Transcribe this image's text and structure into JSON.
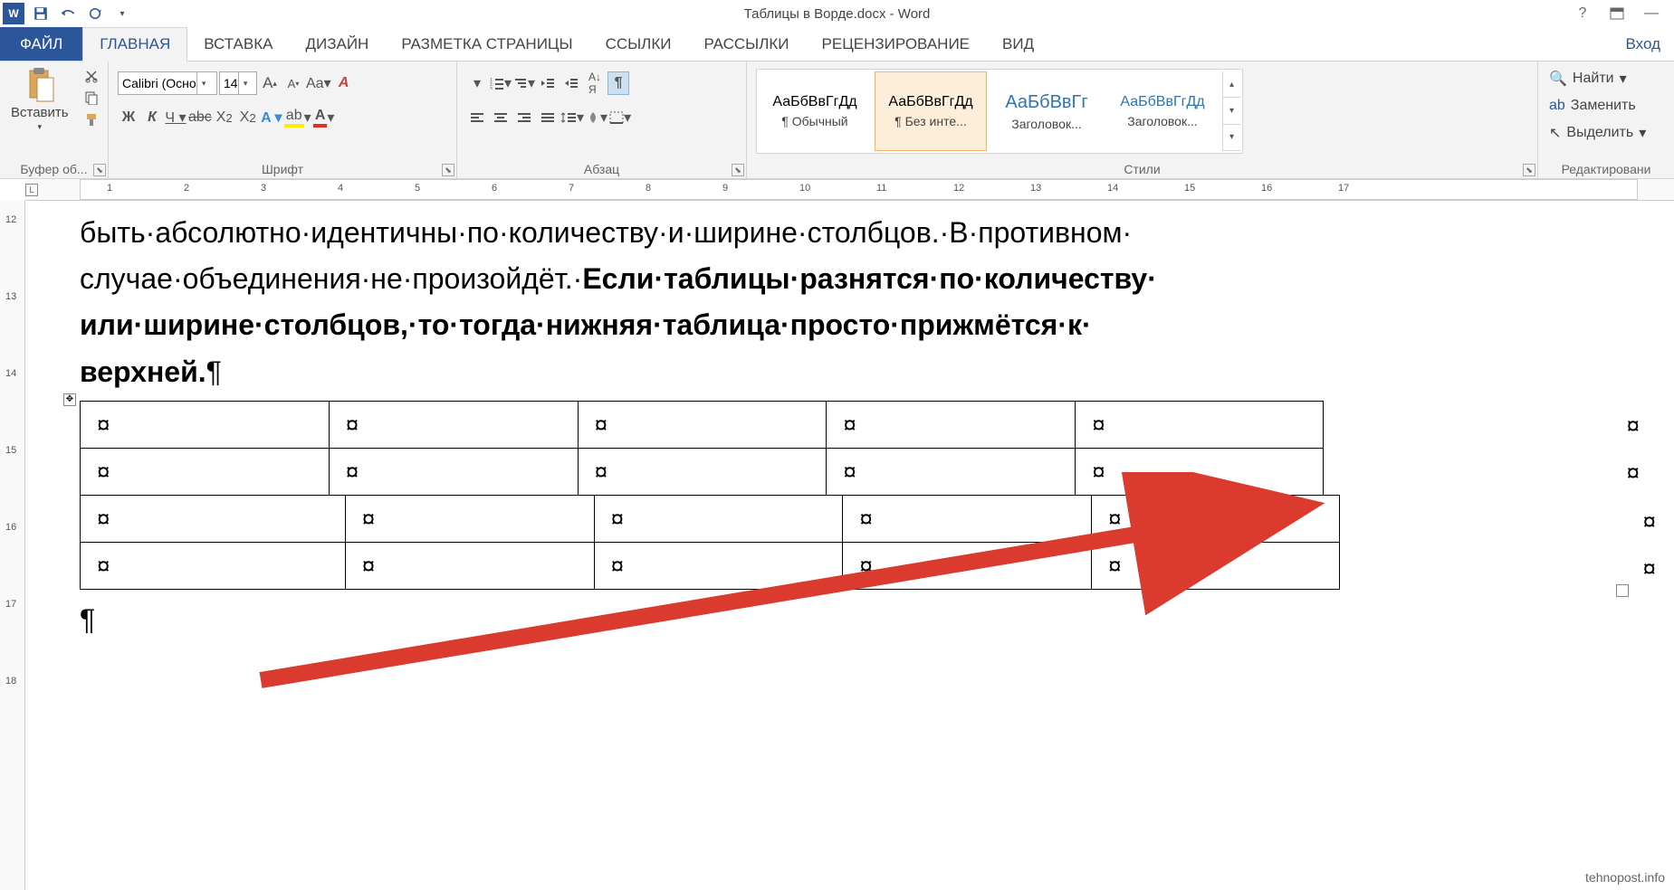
{
  "titlebar": {
    "title": "Таблицы в Ворде.docx - Word",
    "login": "Вход"
  },
  "tabs": {
    "file": "ФАЙЛ",
    "items": [
      "ГЛАВНАЯ",
      "ВСТАВКА",
      "ДИЗАЙН",
      "РАЗМЕТКА СТРАНИЦЫ",
      "ССЫЛКИ",
      "РАССЫЛКИ",
      "РЕЦЕНЗИРОВАНИЕ",
      "ВИД"
    ]
  },
  "ribbon": {
    "clipboard": {
      "paste": "Вставить",
      "label": "Буфер об..."
    },
    "font": {
      "name": "Calibri (Осно",
      "size": "14",
      "label": "Шрифт"
    },
    "paragraph": {
      "label": "Абзац"
    },
    "styles": {
      "label": "Стили",
      "items": [
        {
          "preview": "АаБбВвГгДд",
          "name": "¶ Обычный",
          "color": "#000"
        },
        {
          "preview": "АаБбВвГгДд",
          "name": "¶ Без инте...",
          "color": "#000"
        },
        {
          "preview": "АаБбВвГг",
          "name": "Заголовок...",
          "color": "#2e74b5"
        },
        {
          "preview": "АаБбВвГгДд",
          "name": "Заголовок...",
          "color": "#2e74b5"
        }
      ]
    },
    "editing": {
      "find": "Найти",
      "replace": "Заменить",
      "select": "Выделить",
      "label": "Редактировани"
    }
  },
  "ruler_h": [
    "1",
    "2",
    "3",
    "4",
    "5",
    "6",
    "7",
    "8",
    "9",
    "10",
    "11",
    "12",
    "13",
    "14",
    "15",
    "16",
    "17"
  ],
  "ruler_v": [
    "12",
    "13",
    "14",
    "15",
    "16",
    "17",
    "18"
  ],
  "document": {
    "line1a": "быть·абсолютно·идентичны·по·количеству·и·ширине·столбцов.·В·противном·",
    "line2a": "случае·объединения·не·произойдёт.·",
    "line2b": "Если·таблицы·разнятся·по·количеству·",
    "line3b": "или·ширине·столбцов,·то·тогда·нижняя·таблица·просто·прижмётся·к·",
    "line4b": "верхней.",
    "pilcrow": "¶",
    "cell": "¤"
  },
  "watermark": "tehnopost.info"
}
